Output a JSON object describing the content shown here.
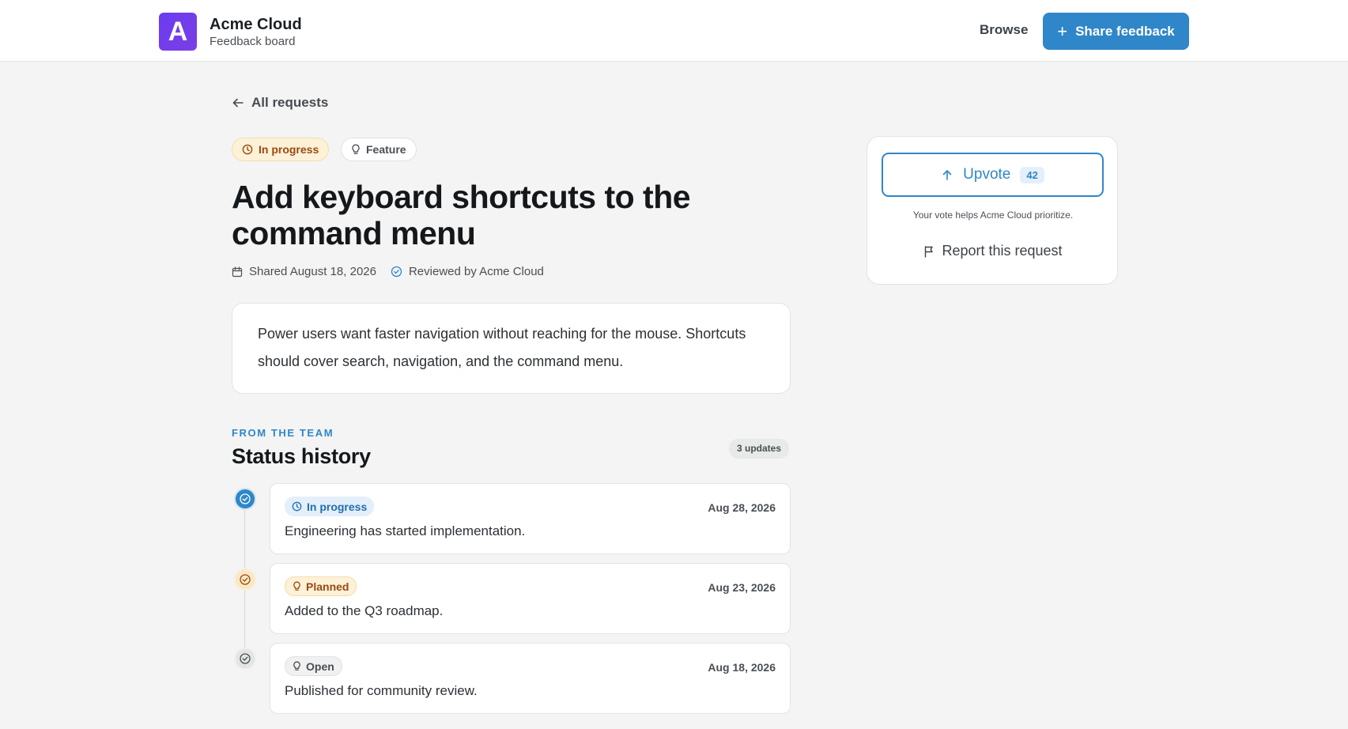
{
  "header": {
    "logo_letter": "A",
    "brand_name": "Acme Cloud",
    "brand_subtitle": "Feedback board",
    "browse_label": "Browse",
    "share_label": "Share feedback"
  },
  "back_link": "All requests",
  "tags": {
    "status": "In progress",
    "category": "Feature"
  },
  "request": {
    "title": "Add keyboard shortcuts to the command menu",
    "shared": "Shared August 18, 2026",
    "reviewed": "Reviewed by Acme Cloud",
    "description": "Power users want faster navigation without reaching for the mouse. Shortcuts should cover search, navigation, and the command menu."
  },
  "history": {
    "eyebrow": "FROM THE TEAM",
    "title": "Status history",
    "count_label": "3 updates",
    "updates": [
      {
        "status": "In progress",
        "date": "Aug 28, 2026",
        "text": "Engineering has started implementation."
      },
      {
        "status": "Planned",
        "date": "Aug 23, 2026",
        "text": "Added to the Q3 roadmap."
      },
      {
        "status": "Open",
        "date": "Aug 18, 2026",
        "text": "Published for community review."
      }
    ]
  },
  "vote": {
    "label": "Upvote",
    "count": "42",
    "note": "Your vote helps Acme Cloud prioritize.",
    "report_label": "Report this request"
  },
  "colors": {
    "accent": "#2f86c8",
    "brand": "#6a3cf0",
    "in_progress": "#9a4a10",
    "background": "#f3f4f3"
  }
}
